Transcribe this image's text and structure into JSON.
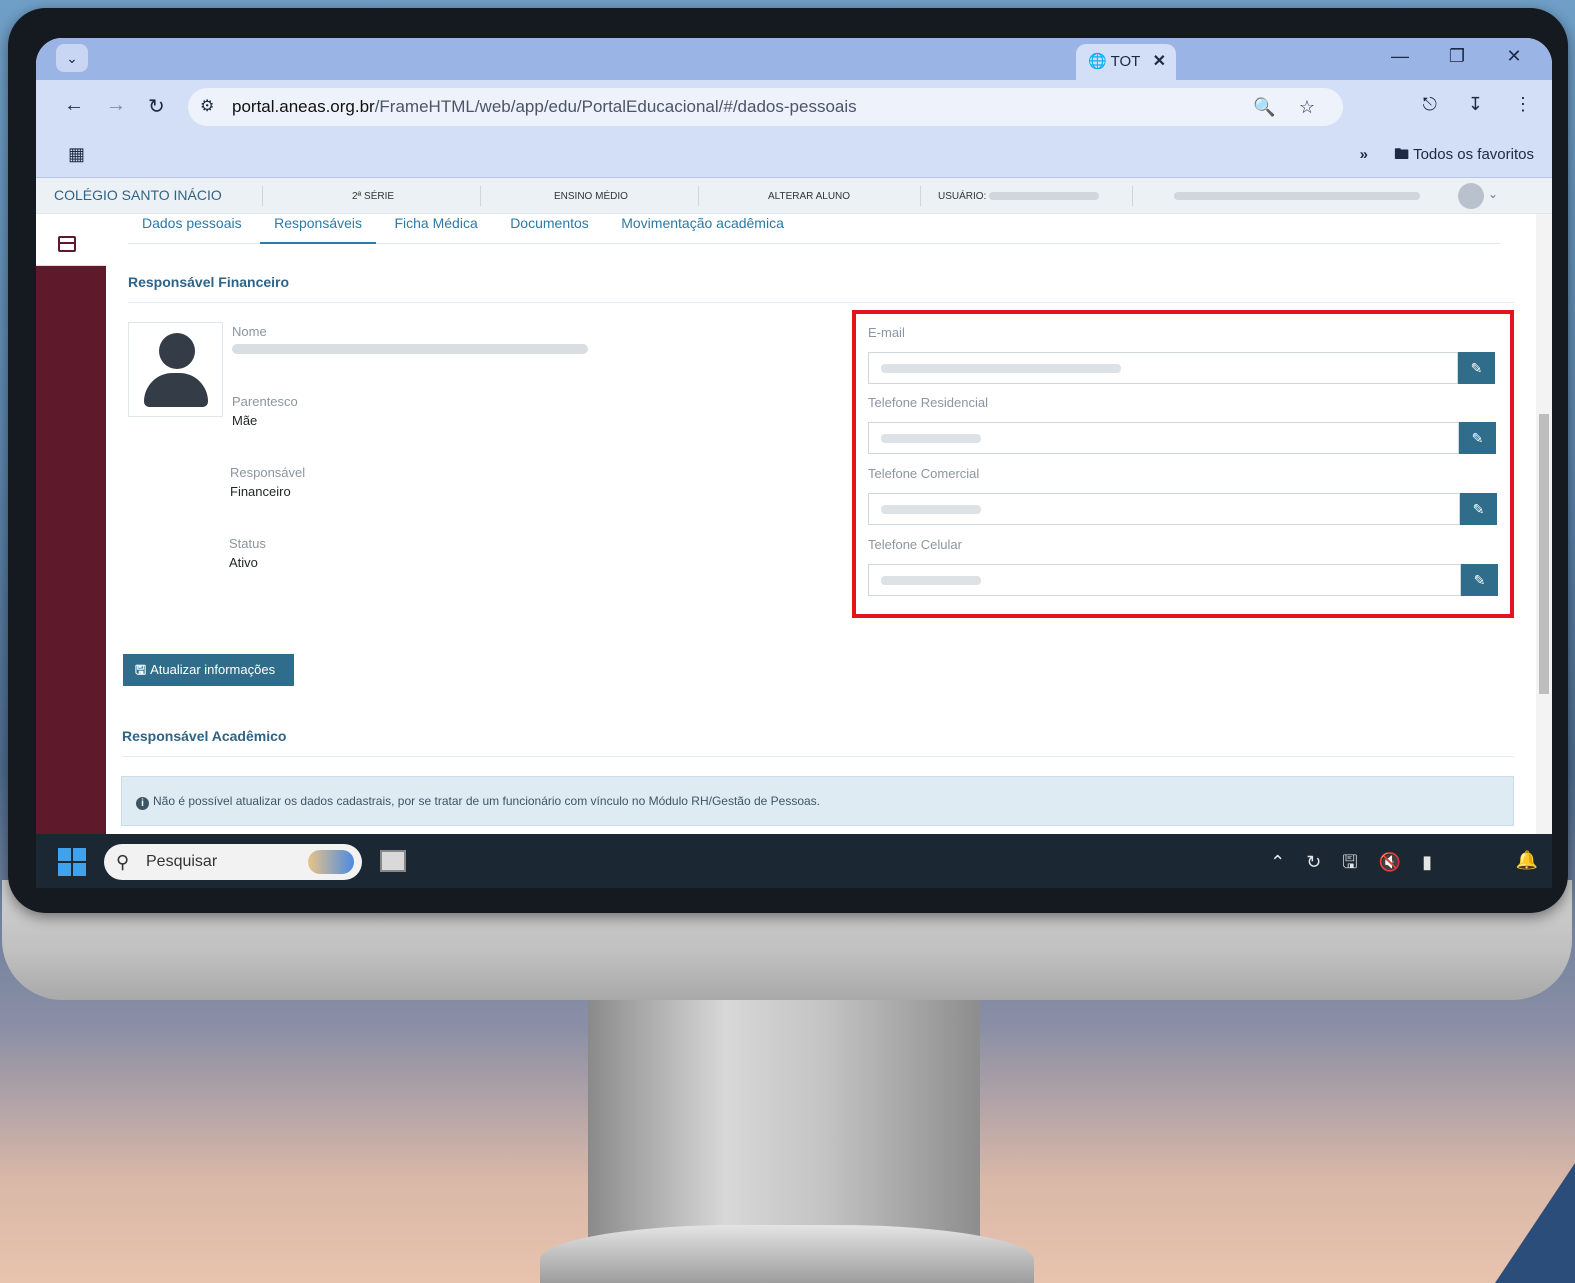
{
  "browser": {
    "tab_title": "TOT",
    "url_host": "portal.aneas.org.br",
    "url_path": "/FrameHTML/web/app/edu/PortalEducacional/#/dados-pessoais",
    "bookmarks_folder": "Todos os favoritos"
  },
  "header": {
    "school": "COLÉGIO SANTO INÁCIO",
    "serie": "2ª SÉRIE",
    "ensino": "ENSINO MÉDIO",
    "alterar": "ALTERAR ALUNO",
    "usuario_label": "USUÁRIO:"
  },
  "tabs": [
    {
      "label": "Dados pessoais"
    },
    {
      "label": "Responsáveis"
    },
    {
      "label": "Ficha Médica"
    },
    {
      "label": "Documentos"
    },
    {
      "label": "Movimentação acadêmica"
    }
  ],
  "financeiro": {
    "title": "Responsável Financeiro",
    "nome_label": "Nome",
    "parentesco_label": "Parentesco",
    "parentesco_value": "Mãe",
    "responsavel_label": "Responsável",
    "responsavel_value": "Financeiro",
    "status_label": "Status",
    "status_value": "Ativo"
  },
  "contact_fields": [
    {
      "label": "E-mail"
    },
    {
      "label": "Telefone Residencial"
    },
    {
      "label": "Telefone Comercial"
    },
    {
      "label": "Telefone Celular"
    }
  ],
  "save_button": "Atualizar informações",
  "academico": {
    "title": "Responsável Acadêmico",
    "alert": "Não é possível atualizar os dados cadastrais, por se tratar de um funcionário com vínculo no Módulo RH/Gestão de Pessoas."
  },
  "taskbar": {
    "search_placeholder": "Pesquisar"
  },
  "colors": {
    "accent": "#2f6d8a",
    "highlight": "#e3141b",
    "sidebar": "#5e1a2a"
  }
}
